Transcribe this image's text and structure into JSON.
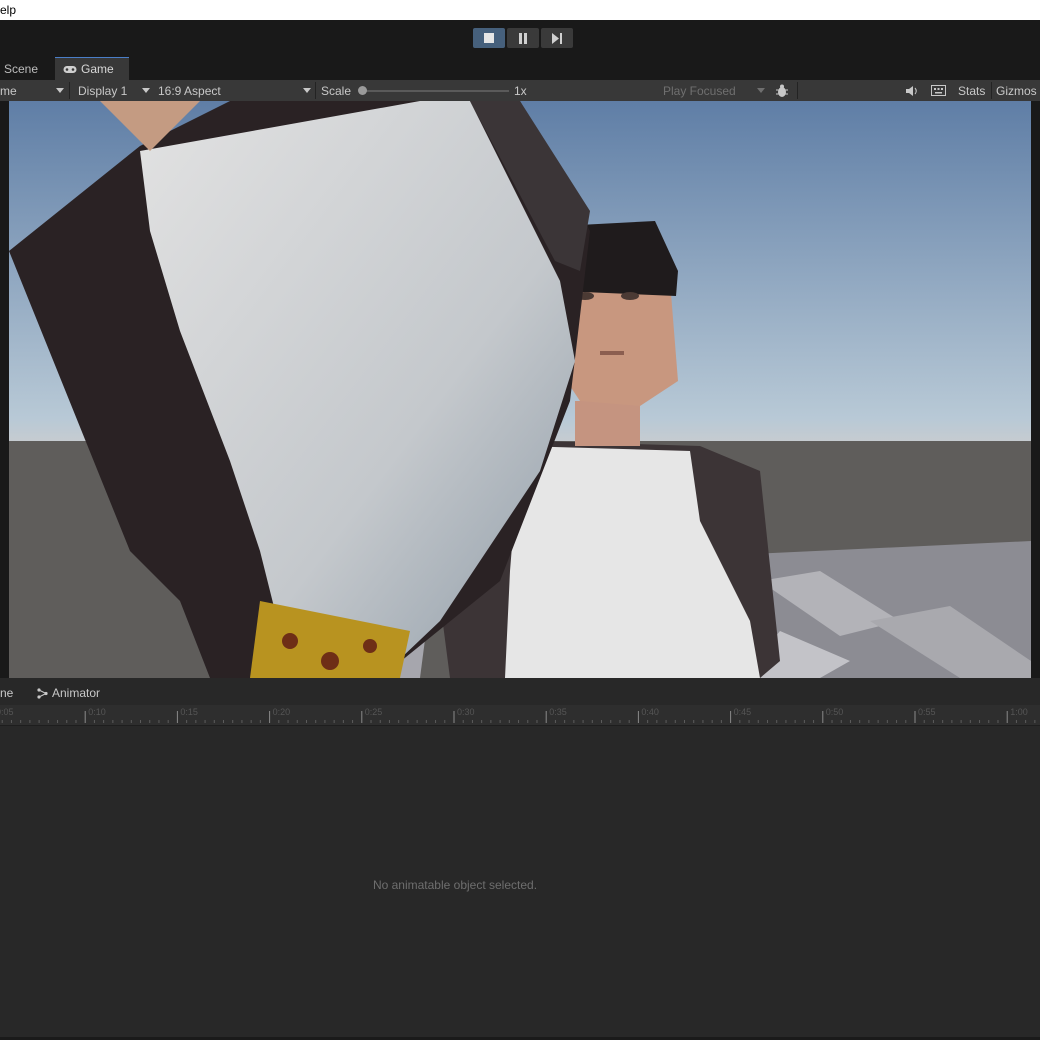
{
  "menubar": {
    "help_label": "elp"
  },
  "toolbar": {
    "play_buttons": [
      {
        "name": "stop-icon",
        "active": true
      },
      {
        "name": "pause-icon",
        "active": false
      },
      {
        "name": "step-icon",
        "active": false
      }
    ]
  },
  "tabs": {
    "scene": "Scene",
    "game": "Game"
  },
  "game_bar": {
    "game_dropdown": "me",
    "display": "Display 1",
    "aspect": "16:9 Aspect",
    "scale_label": "Scale",
    "scale_value": "1x",
    "play_focused": "Play Focused",
    "stats": "Stats",
    "gizmos": "Gizmos"
  },
  "animation": {
    "timeline_tab": "ne",
    "animator_tab": "Animator",
    "ticks": [
      "0:05",
      "0:10",
      "0:15",
      "0:20",
      "0:25",
      "0:30",
      "0:35",
      "0:40",
      "0:45",
      "0:50",
      "0:55",
      "1:00"
    ],
    "empty_message": "No animatable object selected."
  }
}
